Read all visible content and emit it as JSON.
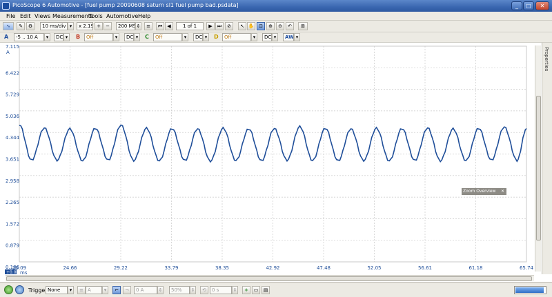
{
  "window": {
    "title": "PicoScope 6 Automotive - [fuel pump 20090608 saturn sl1 fuel pump bad.psdata]",
    "controls": [
      "_",
      "□",
      "✕"
    ]
  },
  "menu": [
    "File",
    "Edit",
    "Views",
    "Measurements",
    "Tools",
    "Automotive",
    "Help"
  ],
  "toolbar": {
    "timebase": "10 ms/div",
    "zoom": "x 2.19",
    "samples": "200 MS",
    "buffer": "1 of 1"
  },
  "channels": [
    {
      "letter": "A",
      "range": "-5 .. 10 A",
      "coupling": "DC",
      "color": "#1f4fa0"
    },
    {
      "letter": "B",
      "range": "Off",
      "coupling": "DC",
      "color": "#c0301a"
    },
    {
      "letter": "C",
      "range": "Off",
      "coupling": "DC",
      "color": "#2f8a2f"
    },
    {
      "letter": "D",
      "range": "Off",
      "coupling": "DC",
      "color": "#c8a000"
    }
  ],
  "ch_extra": "AW",
  "side_panel": {
    "label": "Properties"
  },
  "zoom_overview": {
    "label": "Zoom Overview"
  },
  "chart_data": {
    "type": "line",
    "series": [
      {
        "color": "#1f4e99",
        "x": [
          20.09,
          21.19,
          22.34,
          23.49,
          24.64,
          25.79,
          26.94,
          28.09,
          29.24,
          30.39,
          31.54,
          32.69,
          33.84,
          34.99,
          36.14,
          37.29,
          38.44,
          39.59,
          40.74,
          41.89,
          43.04,
          44.19,
          45.34,
          46.49,
          47.64,
          48.79,
          49.94,
          51.09,
          52.24,
          53.39,
          54.54,
          55.69,
          56.84,
          57.99,
          59.14,
          60.29,
          61.44,
          62.59,
          63.74,
          64.89,
          65.74
        ],
        "y": [
          4.6,
          3.45,
          4.49,
          3.45,
          4.46,
          3.43,
          4.48,
          3.45,
          4.58,
          3.44,
          4.48,
          3.43,
          4.47,
          3.44,
          4.46,
          3.42,
          4.48,
          3.44,
          4.46,
          3.43,
          4.47,
          3.45,
          4.53,
          3.44,
          4.48,
          3.43,
          4.46,
          3.44,
          4.48,
          3.43,
          4.47,
          3.44,
          4.49,
          3.43,
          4.46,
          3.44,
          4.48,
          3.45,
          4.52,
          3.44,
          4.47
        ]
      }
    ],
    "ylabel": "A",
    "xlabel": "ms",
    "yticks": [
      "6.422",
      "5.729",
      "5.036",
      "4.344",
      "3.651",
      "2.958",
      "2.265",
      "1.572",
      "0.879",
      "0.186"
    ],
    "xticks": [
      "20.09",
      "24.66",
      "29.22",
      "33.79",
      "38.35",
      "42.92",
      "47.48",
      "52.05",
      "56.61",
      "61.18",
      "65.74"
    ],
    "ytop": "7.115",
    "xlim": [
      20.09,
      65.74
    ],
    "ylim": [
      0.186,
      7.115
    ],
    "grid": true,
    "axis_marker": "+0.0"
  },
  "statusbar": {
    "trigger_label": "Trigger",
    "trigger_mode": "None",
    "source": "A",
    "level": "0 A",
    "pretrigger": "50%",
    "delay": "0 s",
    "progress": 0.95
  }
}
